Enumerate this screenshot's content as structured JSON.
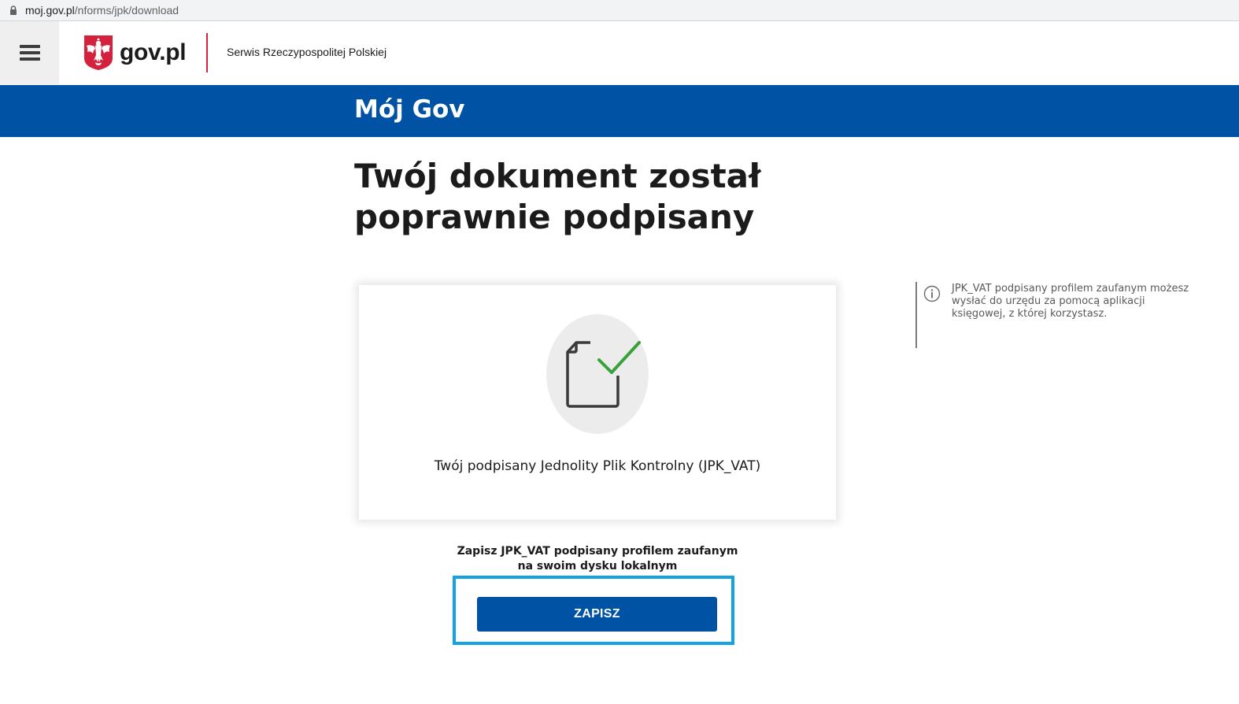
{
  "browser": {
    "url_host": "moj.gov.pl",
    "url_path": "/nforms/jpk/download"
  },
  "header": {
    "logo_text": "gov.pl",
    "tagline": "Serwis Rzeczypospolitej Polskiej"
  },
  "band": {
    "title": "Mój Gov"
  },
  "main": {
    "title": "Twój dokument został poprawnie podpisany",
    "card_caption": "Twój podpisany Jednolity Plik Kontrolny (JPK_VAT)",
    "save_hint_line1": "Zapisz JPK_VAT podpisany profilem zaufanym",
    "save_hint_line2": "na swoim dysku lokalnym",
    "save_button_label": "ZAPISZ"
  },
  "sidebar_info": {
    "text": "JPK_VAT podpisany profilem zaufanym możesz wysłać do urzędu za pomocą aplikacji księgowej, z której korzystasz."
  },
  "colors": {
    "brand_blue": "#0052a5",
    "highlight": "#14a3e2",
    "check_green": "#3aa13a",
    "divider_red": "#d4213d"
  },
  "icons": {
    "menu": "hamburger-icon",
    "lock": "lock-icon",
    "emblem": "polish-eagle-emblem",
    "document": "document-check-icon",
    "info": "info-icon"
  }
}
